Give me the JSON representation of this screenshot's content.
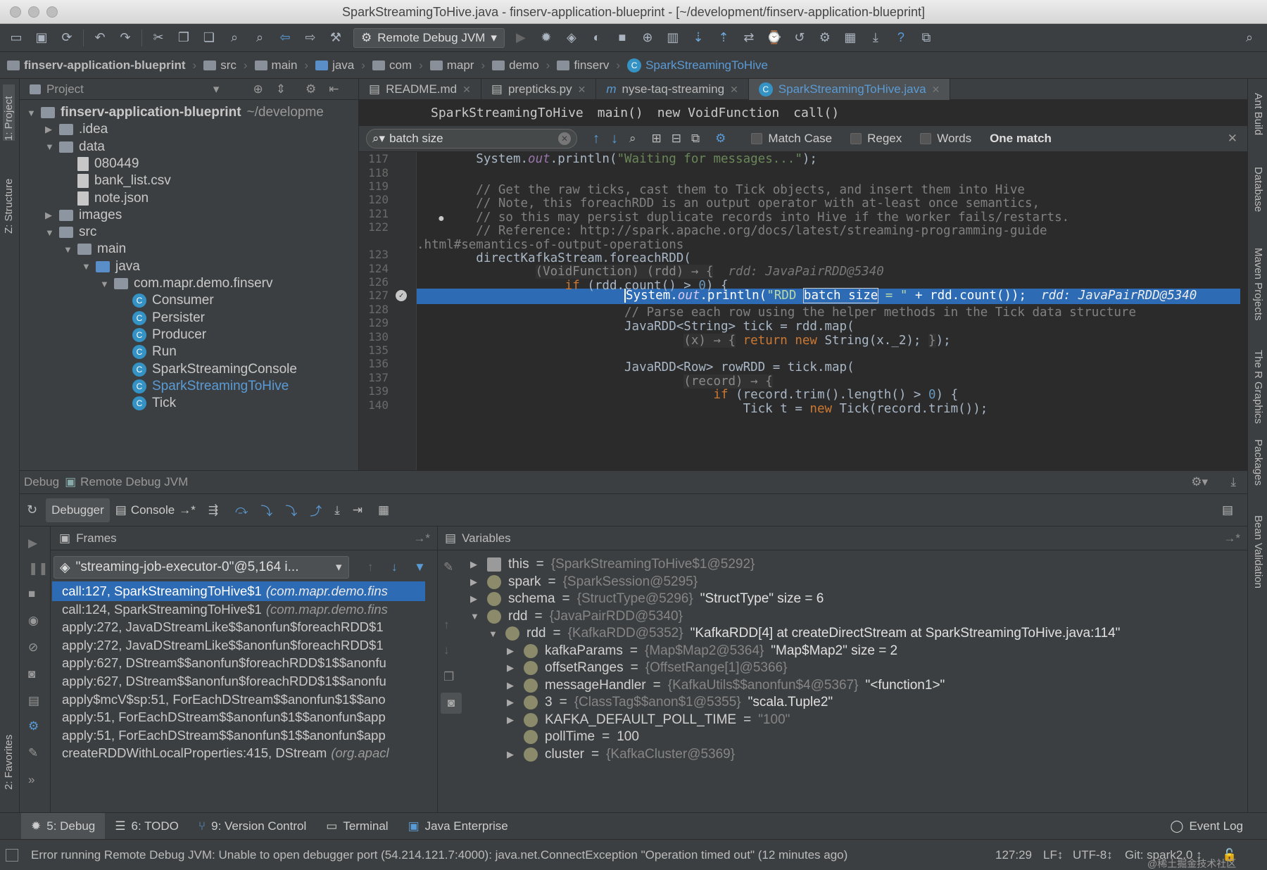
{
  "window": {
    "title": "SparkStreamingToHive.java - finserv-application-blueprint - [~/development/finserv-application-blueprint]"
  },
  "toolbar": {
    "run_config": "Remote Debug JVM"
  },
  "navbar": {
    "crumbs": [
      "finserv-application-blueprint",
      "src",
      "main",
      "java",
      "com",
      "mapr",
      "demo",
      "finserv",
      "SparkStreamingToHive"
    ]
  },
  "left_stripe": {
    "project": "1: Project",
    "structure": "Z: Structure",
    "favorites": "2: Favorites"
  },
  "right_stripe": {
    "ant": "Ant Build",
    "database": "Database",
    "maven": "Maven Projects",
    "rgraphics": "The R Graphics",
    "packages": "Packages",
    "bean": "Bean Validation"
  },
  "project": {
    "header": "Project",
    "tree": [
      {
        "label": "finserv-application-blueprint",
        "suffix": "~/developme",
        "kind": "root"
      },
      {
        "label": ".idea",
        "kind": "folder"
      },
      {
        "label": "data",
        "kind": "folder"
      },
      {
        "label": "080449",
        "kind": "file"
      },
      {
        "label": "bank_list.csv",
        "kind": "file"
      },
      {
        "label": "note.json",
        "kind": "file"
      },
      {
        "label": "images",
        "kind": "folder"
      },
      {
        "label": "src",
        "kind": "folder"
      },
      {
        "label": "main",
        "kind": "folder"
      },
      {
        "label": "java",
        "kind": "folder"
      },
      {
        "label": "com.mapr.demo.finserv",
        "kind": "folder"
      },
      {
        "label": "Consumer",
        "kind": "class"
      },
      {
        "label": "Persister",
        "kind": "class"
      },
      {
        "label": "Producer",
        "kind": "class"
      },
      {
        "label": "Run",
        "kind": "class"
      },
      {
        "label": "SparkStreamingConsole",
        "kind": "class"
      },
      {
        "label": "SparkStreamingToHive",
        "kind": "class"
      },
      {
        "label": "Tick",
        "kind": "class"
      }
    ]
  },
  "editor": {
    "tabs": [
      "README.md",
      "prepticks.py",
      "nyse-taq-streaming",
      "SparkStreamingToHive.java"
    ],
    "breadcrumb": [
      "SparkStreamingToHive",
      "main()",
      "new VoidFunction",
      "call()"
    ],
    "find": {
      "query": "batch size",
      "match_case": "Match Case",
      "regex": "Regex",
      "words": "Words",
      "result": "One match"
    },
    "line_numbers": [
      "117",
      "118",
      "119",
      "120",
      "121",
      "122",
      "",
      "123",
      "124",
      "126",
      "127",
      "128",
      "129",
      "130",
      "135",
      "136",
      "137",
      "139",
      "140"
    ]
  },
  "debug": {
    "header_label": "Debug",
    "header_config": "Remote Debug JVM",
    "tab_debugger": "Debugger",
    "tab_console": "Console",
    "frames_title": "Frames",
    "variables_title": "Variables",
    "thread": "\"streaming-job-executor-0\"@5,164 i...",
    "frames": [
      {
        "method": "call:127, SparkStreamingToHive$1",
        "pkg": "(com.mapr.demo.fins"
      },
      {
        "method": "call:124, SparkStreamingToHive$1",
        "pkg": "(com.mapr.demo.fins"
      },
      {
        "method": "apply:272, JavaDStreamLike$$anonfun$foreachRDD$1",
        "pkg": ""
      },
      {
        "method": "apply:272, JavaDStreamLike$$anonfun$foreachRDD$1",
        "pkg": ""
      },
      {
        "method": "apply:627, DStream$$anonfun$foreachRDD$1$$anonfu",
        "pkg": ""
      },
      {
        "method": "apply:627, DStream$$anonfun$foreachRDD$1$$anonfu",
        "pkg": ""
      },
      {
        "method": "apply$mcV$sp:51, ForEachDStream$$anonfun$1$$ano",
        "pkg": ""
      },
      {
        "method": "apply:51, ForEachDStream$$anonfun$1$$anonfun$app",
        "pkg": ""
      },
      {
        "method": "apply:51, ForEachDStream$$anonfun$1$$anonfun$app",
        "pkg": ""
      },
      {
        "method": "createRDDWithLocalProperties:415, DStream",
        "pkg": "(org.apacl"
      }
    ],
    "variables": [
      {
        "name": "this",
        "ref": "{SparkStreamingToHive$1@5292}",
        "extra": ""
      },
      {
        "name": "spark",
        "ref": "{SparkSession@5295}",
        "extra": ""
      },
      {
        "name": "schema",
        "ref": "{StructType@5296}",
        "extra": "\"StructType\" size = 6"
      },
      {
        "name": "rdd",
        "ref": "{JavaPairRDD@5340}",
        "extra": ""
      },
      {
        "name": "rdd",
        "ref": "{KafkaRDD@5352}",
        "extra": "\"KafkaRDD[4] at createDirectStream at SparkStreamingToHive.java:114\""
      },
      {
        "name": "kafkaParams",
        "ref": "{Map$Map2@5364}",
        "extra": "\"Map$Map2\" size = 2"
      },
      {
        "name": "offsetRanges",
        "ref": "{OffsetRange[1]@5366}",
        "extra": ""
      },
      {
        "name": "messageHandler",
        "ref": "{KafkaUtils$$anonfun$4@5367}",
        "extra": "\"<function1>\""
      },
      {
        "name": "3",
        "ref": "{ClassTag$$anon$1@5355}",
        "extra": "\"scala.Tuple2\""
      },
      {
        "name": "KAFKA_DEFAULT_POLL_TIME",
        "ref": "\"100\"",
        "extra": ""
      },
      {
        "name": "pollTime",
        "ref": "100",
        "extra": ""
      },
      {
        "name": "cluster",
        "ref": "{KafkaCluster@5369}",
        "extra": ""
      }
    ]
  },
  "toolwindows": {
    "debug": "5: Debug",
    "todo": "6: TODO",
    "vcs": "9: Version Control",
    "terminal": "Terminal",
    "javaee": "Java Enterprise",
    "eventlog": "Event Log"
  },
  "status": {
    "message": "Error running Remote Debug JVM: Unable to open debugger port (54.214.121.7:4000): java.net.ConnectException \"Operation timed out\" (12 minutes ago)",
    "position": "127:29",
    "line_sep": "LF↕",
    "encoding": "UTF-8↕",
    "git": "Git: spark2.0 ↕",
    "watermark": "@稀土掘金技术社区"
  }
}
